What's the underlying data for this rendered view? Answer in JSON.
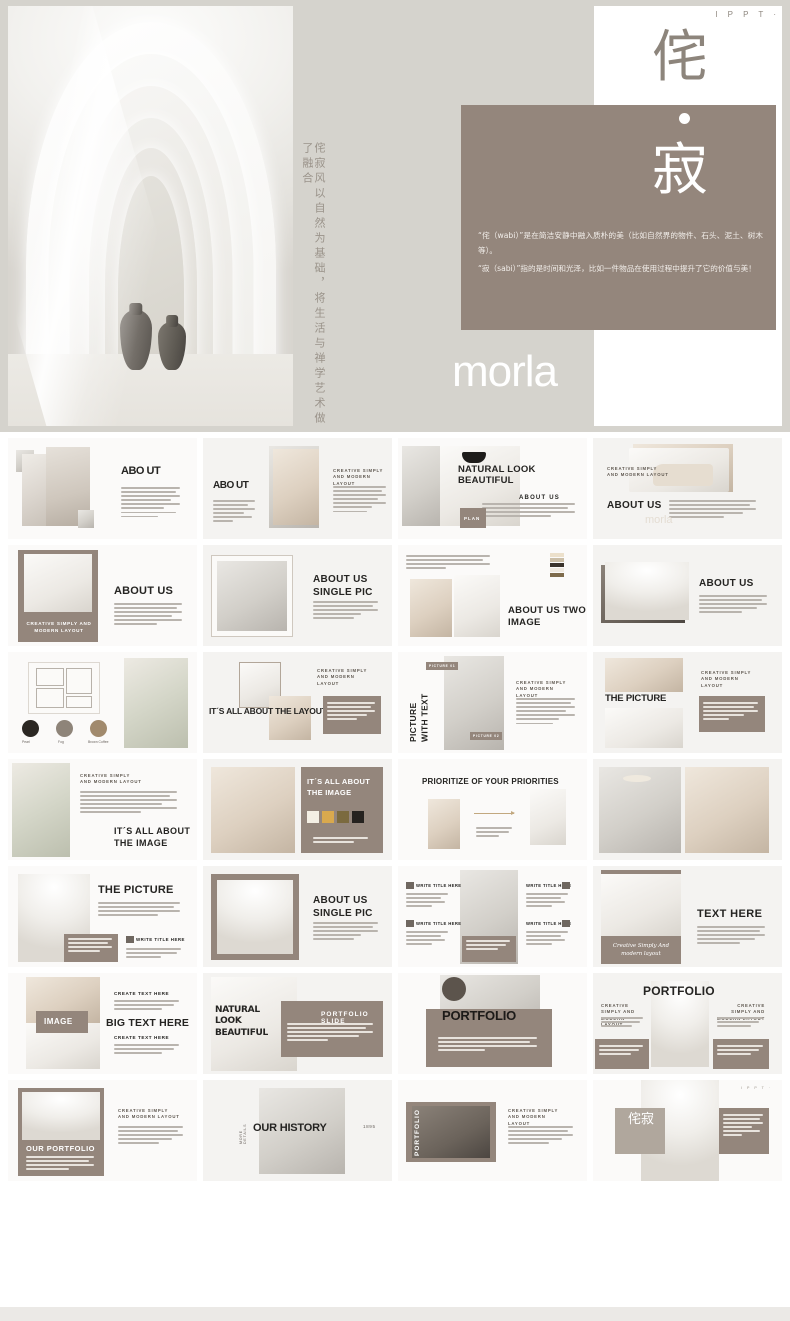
{
  "hero": {
    "brand_tag": "I P P T ·",
    "kanji_wabi": "侘",
    "kanji_sabi": "寂",
    "vertical_text": "侘寂风以自然为基础，将生活与禅学艺术做了融合",
    "paragraph_1": "“侘（wabi）”是在简洁安静中融入质朴的美（比如自然界的物件、石头、泥土、树木等）。",
    "paragraph_2": "“寂（sabi）”指的是时间和光泽，比如一件物品在使用过程中提升了它的价值与美！",
    "wordmark": "morla",
    "colors": {
      "background": "#d5d3cd",
      "brown_panel": "#94867c",
      "white_panel": "#ffffff",
      "kanji_brown": "#8d857c"
    }
  },
  "palette": {
    "brown": "#94867c",
    "brown_dark": "#82756b",
    "slide_bg": "#f4f3f1",
    "text_dark": "#252422",
    "cream": "#efe7dc",
    "mustard": "#d9a94e",
    "olive": "#7b6a3f",
    "charcoal": "#25221f"
  },
  "slides": [
    {
      "id": 1,
      "row": 1,
      "col": 1,
      "title": "ABO UT",
      "subtitle": "",
      "note": "about-layout-image-left"
    },
    {
      "id": 2,
      "row": 1,
      "col": 2,
      "title": "ABO UT",
      "subtitle": "CREATIVE SIMPLY AND MODERN LAYOUT",
      "note": "about-layout-image-right"
    },
    {
      "id": 3,
      "row": 1,
      "col": 3,
      "title": "NATURAL LOOK BEAUTIFUL",
      "subtitle": "ABOUT US",
      "badge": "PLAN",
      "note": "natural-look"
    },
    {
      "id": 4,
      "row": 1,
      "col": 4,
      "title": "ABOUT US",
      "subtitle": "CREATIVE SIMPLY AND MODERN LAYOUT",
      "watermark": "morla",
      "note": "about-us-sofa"
    },
    {
      "id": 5,
      "row": 2,
      "col": 1,
      "title": "ABOUT US",
      "caption": "CREATIVE SIMPLY AND MODERN LAYOUT",
      "note": "about-us-caption-photo"
    },
    {
      "id": 6,
      "row": 2,
      "col": 2,
      "title": "ABOUT US SINGLE PIC",
      "subtitle": "",
      "note": "single-pic-frame"
    },
    {
      "id": 7,
      "row": 2,
      "col": 3,
      "title": "ABOUT US TWO IMAGE",
      "subtitle": "",
      "note": "two-image-swatches"
    },
    {
      "id": 8,
      "row": 2,
      "col": 4,
      "title": "ABOUT US",
      "subtitle": "",
      "note": "about-us-arch"
    },
    {
      "id": 9,
      "row": 3,
      "col": 1,
      "title": "",
      "swatch_labels": [
        "Pearl",
        "Fog",
        "Brown Coffee"
      ],
      "note": "floorplan-swatches"
    },
    {
      "id": 10,
      "row": 3,
      "col": 2,
      "title": "IT´S ALL ABOUT THE LAYOUT",
      "subtitle": "CREATIVE SIMPLY AND MODERN LAYOUT",
      "note": "layout-collage"
    },
    {
      "id": 11,
      "row": 3,
      "col": 3,
      "title": "PICTURE WITH TEXT",
      "subtitle": "CREATIVE SIMPLY AND MODERN LAYOUT",
      "tags": [
        "PICTURE 01",
        "PICTURE 02"
      ],
      "note": "picture-with-text"
    },
    {
      "id": 12,
      "row": 3,
      "col": 4,
      "title": "THE PICTURE",
      "subtitle": "CREATIVE SIMPLY AND MODERN LAYOUT",
      "note": "the-picture-two-photo"
    },
    {
      "id": 13,
      "row": 4,
      "col": 1,
      "title": "IT´S ALL ABOUT THE IMAGE",
      "subtitle": "CREATIVE SIMPLY AND MODERN LAYOUT",
      "note": "image-plant"
    },
    {
      "id": 14,
      "row": 4,
      "col": 2,
      "title": "IT´S ALL ABOUT THE IMAGE",
      "subtitle": "",
      "note": "image-swatches-brown"
    },
    {
      "id": 15,
      "row": 4,
      "col": 3,
      "title": "PRIORITIZE OF YOUR PRIORITIES",
      "subtitle": "",
      "note": "prioritize-fashion"
    },
    {
      "id": 16,
      "row": 4,
      "col": 4,
      "title": "",
      "subtitle": "",
      "note": "two-photo-kitchen"
    },
    {
      "id": 17,
      "row": 5,
      "col": 1,
      "title": "THE PICTURE",
      "subtitle": "WRITE TITLE HERE",
      "note": "the-picture-arch"
    },
    {
      "id": 18,
      "row": 5,
      "col": 2,
      "title": "ABOUT US SINGLE PIC",
      "subtitle": "",
      "note": "single-pic-brown-frame"
    },
    {
      "id": 19,
      "row": 5,
      "col": 3,
      "title": "",
      "items": [
        "WRITE TITLE HERE",
        "WRITE TITLE HERE",
        "WRITE TITLE HERE",
        "WRITE TITLE HERE"
      ],
      "note": "four-feature-center-photo"
    },
    {
      "id": 20,
      "row": 5,
      "col": 4,
      "title": "TEXT HERE",
      "script": "Creative Simply And modern layout",
      "note": "text-here-script"
    },
    {
      "id": 21,
      "row": 6,
      "col": 1,
      "title": "BIG TEXT HERE",
      "badge": "IMAGE",
      "subtitle": "CREATE TEXT HERE",
      "note": "big-text-here"
    },
    {
      "id": 22,
      "row": 6,
      "col": 2,
      "title": "PORTFOLIO SLIDE",
      "script": "NATURAL LOOK BEAUTIFUL",
      "note": "portfolio-slide-script"
    },
    {
      "id": 23,
      "row": 6,
      "col": 3,
      "title": "PORTFOLIO",
      "subtitle": "",
      "note": "portfolio-overlay"
    },
    {
      "id": 24,
      "row": 6,
      "col": 4,
      "title": "PORTFOLIO",
      "subtitle": "CREATIVE SIMPLY AND MODERN LAYOUT",
      "note": "portfolio-symmetric"
    },
    {
      "id": 25,
      "row": 7,
      "col": 1,
      "title": "OUR PORTFOLIO",
      "subtitle": "CREATIVE SIMPLY AND MODERN LAYOUT",
      "note": "our-portfolio"
    },
    {
      "id": 26,
      "row": 7,
      "col": 2,
      "title": "OUR HISTORY",
      "year": "1895",
      "side": "MORE DETAILS",
      "note": "our-history"
    },
    {
      "id": 27,
      "row": 7,
      "col": 3,
      "title": "PORTFOLIO",
      "subtitle": "CREATIVE SIMPLY AND MODERN LAYOUT",
      "note": "portfolio-bedroom"
    },
    {
      "id": 28,
      "row": 7,
      "col": 4,
      "title": "侘寂",
      "brand_tag": "I P P T ·",
      "note": "closing-wabi-sabi"
    }
  ]
}
